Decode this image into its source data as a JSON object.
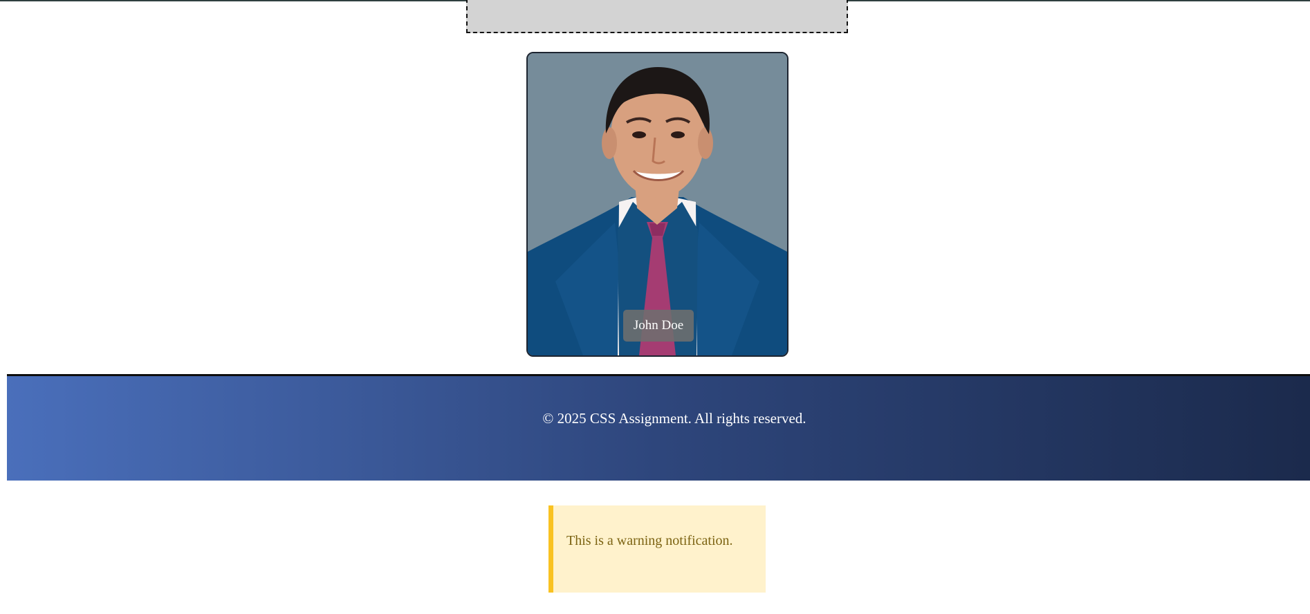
{
  "profile": {
    "name": "John Doe"
  },
  "footer": {
    "text": "© 2025 CSS Assignment. All rights reserved."
  },
  "warning": {
    "message": "This is a warning notification."
  },
  "colors": {
    "placeholder_box": "#d3d3d3",
    "photo_background": "#768c9a",
    "footer_gradient_start": "#4a6fbb",
    "footer_gradient_end": "#1b2a4c",
    "warning_background": "#fff2cc",
    "warning_accent": "#f9c221",
    "warning_text": "#7c6312"
  }
}
